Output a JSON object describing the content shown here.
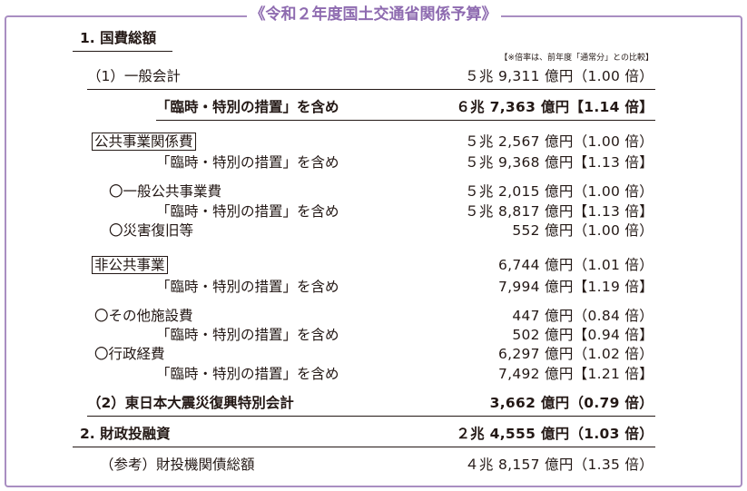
{
  "title": "《令和２年度国土交通省関係予算》",
  "note": "【※倍率は、前年度「通常分」との比較】",
  "rows": [
    {
      "label": "1.  国費総額",
      "value": ""
    },
    {
      "label": "（1）一般会計",
      "value": "５兆 9,311 億円（1.00 倍）"
    },
    {
      "label": "「臨時・特別の措置」を含め",
      "value": "６兆 7,363 億円【1.14 倍】"
    },
    {
      "label": "公共事業関係費",
      "value": "５兆 2,567 億円（1.00 倍）"
    },
    {
      "label": "「臨時・特別の措置」を含め",
      "value": "５兆 9,368 億円【1.13 倍】"
    },
    {
      "label": "〇一般公共事業費",
      "value": "５兆 2,015 億円（1.00 倍）"
    },
    {
      "label": "「臨時・特別の措置」を含め",
      "value": "５兆 8,817 億円【1.13 倍】"
    },
    {
      "label": "〇災害復旧等",
      "value": "552 億円（1.00 倍）"
    },
    {
      "label": "非公共事業",
      "value": "6,744 億円（1.01 倍）"
    },
    {
      "label": "「臨時・特別の措置」を含め",
      "value": "7,994 億円【1.19 倍】"
    },
    {
      "label": "〇その他施設費",
      "value": "447 億円（0.84 倍）"
    },
    {
      "label": "「臨時・特別の措置」を含め",
      "value": "502 億円【0.94 倍】"
    },
    {
      "label": "〇行政経費",
      "value": "6,297 億円（1.02 倍）"
    },
    {
      "label": "「臨時・特別の措置」を含め",
      "value": "7,492 億円【1.21 倍】"
    },
    {
      "label": "（2）東日本大震災復興特別会計",
      "value": "3,662 億円（0.79 倍）"
    },
    {
      "label": "2.  財政投融資",
      "value": "２兆 4,555 億円（1.03 倍）"
    },
    {
      "label": "（参考）財投機関債総額",
      "value": "４兆 8,157 億円（1.35 倍）"
    }
  ]
}
